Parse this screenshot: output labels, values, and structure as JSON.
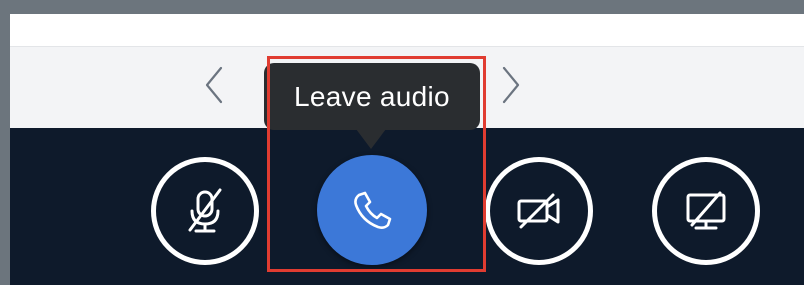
{
  "tooltip": {
    "text": "Leave audio"
  },
  "controls": [
    {
      "name": "mute-microphone-button",
      "icon": "microphone-muted-icon",
      "state": "muted"
    },
    {
      "name": "leave-audio-button",
      "icon": "phone-icon",
      "state": "active"
    },
    {
      "name": "camera-button",
      "icon": "camera-off-icon",
      "state": "off"
    },
    {
      "name": "screen-share-button",
      "icon": "screen-share-off-icon",
      "state": "off"
    }
  ],
  "navigation": {
    "prev_icon": "chevron-left-icon",
    "next_icon": "chevron-right-icon"
  },
  "colors": {
    "control_bar": "#0e1a2b",
    "leave_audio_button": "#3c78d8",
    "tooltip_background": "#2a2d30",
    "highlight": "#e03c31",
    "frame": "#6c757d"
  }
}
